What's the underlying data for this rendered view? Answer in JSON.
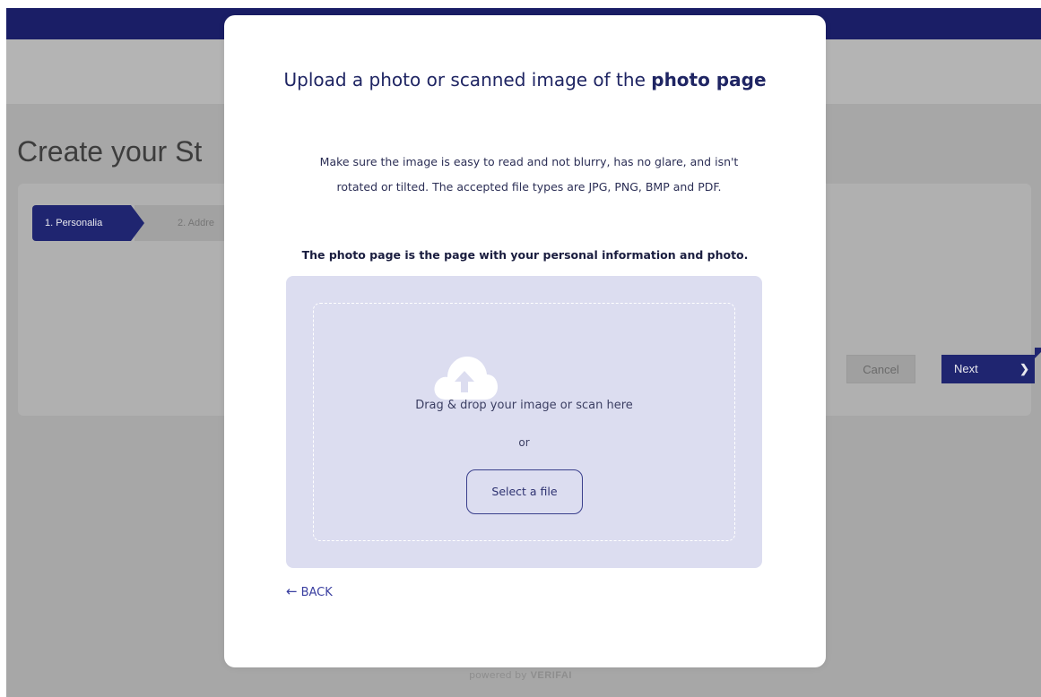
{
  "background": {
    "page_title": "Create your St",
    "steps": [
      {
        "label": "1. Personalia",
        "active": true
      },
      {
        "label": "2. Addre",
        "active": false
      }
    ],
    "cancel_label": "Cancel",
    "next_label": "Next",
    "next_icon": "chevron-right-icon",
    "powered_by": "powered by",
    "brand": "VERIFAI"
  },
  "modal": {
    "title_prefix": "Upload a photo or scanned image of the",
    "title_emphasis": "photo page",
    "description": "Make sure the image is easy to read and not blurry, has no glare, and isn't rotated or tilted. The accepted file types are JPG, PNG, BMP and PDF.",
    "hint": "The photo page is the page with your personal information and photo.",
    "dropzone": {
      "icon": "cloud-upload-icon",
      "drop_text": "Drag & drop your image or scan here",
      "or_text": "or",
      "select_button": "Select a file"
    },
    "back_label": "BACK",
    "back_icon": "arrow-left-icon"
  },
  "colors": {
    "brand_navy": "#1f2570",
    "dropzone_bg": "#dcddf0",
    "overlay_gray": "#a7a7a7"
  }
}
